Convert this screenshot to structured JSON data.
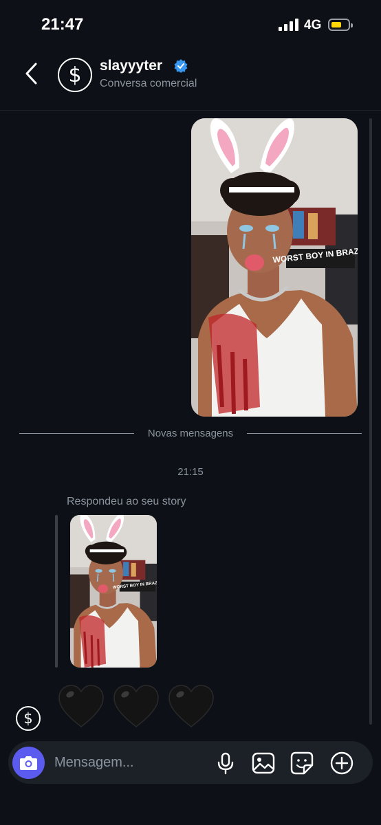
{
  "status_bar": {
    "time": "21:47",
    "network": "4G",
    "battery_color": "#ffd60a"
  },
  "header": {
    "back_icon": "chevron-left-icon",
    "avatar_symbol": "$",
    "name": "slayyyter",
    "verified_icon": "verified-badge-icon",
    "subtitle": "Conversa comercial"
  },
  "story_image": {
    "caption_text": "WORST BOY IN BRAZIL"
  },
  "conversation": {
    "divider_label": "Novas mensagens",
    "timestamp": "21:15",
    "reply_label": "Respondeu ao seu story",
    "sender_avatar_symbol": "$",
    "reaction": [
      "🖤",
      "🖤",
      "🖤"
    ]
  },
  "composer": {
    "placeholder": "Mensagem...",
    "camera_icon": "camera-icon",
    "mic_icon": "microphone-icon",
    "gallery_icon": "image-icon",
    "sticker_icon": "sticker-icon",
    "plus_icon": "plus-icon",
    "accent_color": "#5b5bf0"
  }
}
